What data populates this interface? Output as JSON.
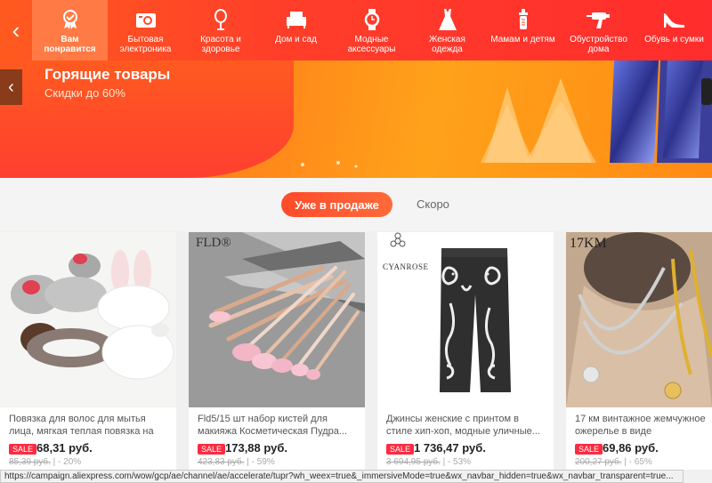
{
  "nav": {
    "categories": [
      {
        "label": "Вам\nпонравится",
        "icon": "ribbon-icon"
      },
      {
        "label": "Бытовая\nэлектроника",
        "icon": "camera-icon"
      },
      {
        "label": "Красота и\nздоровье",
        "icon": "mirror-icon"
      },
      {
        "label": "Дом и сад",
        "icon": "armchair-icon"
      },
      {
        "label": "Модные\nаксессуары",
        "icon": "watch-icon"
      },
      {
        "label": "Женская\nодежда",
        "icon": "dress-icon"
      },
      {
        "label": "Мамам и детям",
        "icon": "baby-bottle-icon"
      },
      {
        "label": "Обустройство\nдома",
        "icon": "drill-icon"
      },
      {
        "label": "Обувь и сумки",
        "icon": "high-heel-icon"
      }
    ]
  },
  "banner": {
    "title": "Горящие товары",
    "subtitle": "Скидки до 60%"
  },
  "tabs": {
    "active": "Уже в продаже",
    "inactive": "Скоро"
  },
  "products": [
    {
      "title": "Повязка для волос для мытья лица, мягкая теплая повязка на голову ...",
      "sale": "SALE",
      "price": "68,31 руб.",
      "old_price": "85,39 руб.",
      "discount": "| - 20%"
    },
    {
      "title": "Fld5/15 шт набор кистей для макияжа Косметическая Пудра...",
      "sale": "SALE",
      "price": "173,88 руб.",
      "old_price": "423,83 руб.",
      "discount": "| - 59%",
      "brand": "FLD®"
    },
    {
      "title": "Джинсы женские с принтом в стиле хип-хоп, модные уличные...",
      "sale": "SALE",
      "price": "1 736,47 руб.",
      "old_price": "3 694,95 руб.",
      "discount": "| - 53%",
      "brand": "CYANROSE"
    },
    {
      "title": "17 км винтажное жемчужное ожерелье в виде виноградных ...",
      "sale": "SALE",
      "price": "69,86 руб.",
      "old_price": "200,27 руб.",
      "discount": "| - 65%",
      "brand": "17KM"
    }
  ],
  "status_url": "https://campaign.aliexpress.com/wow/gcp/ae/channel/ae/accelerate/tupr?wh_weex=true&_immersiveMode=true&wx_navbar_hidden=true&wx_navbar_transparent=true..."
}
